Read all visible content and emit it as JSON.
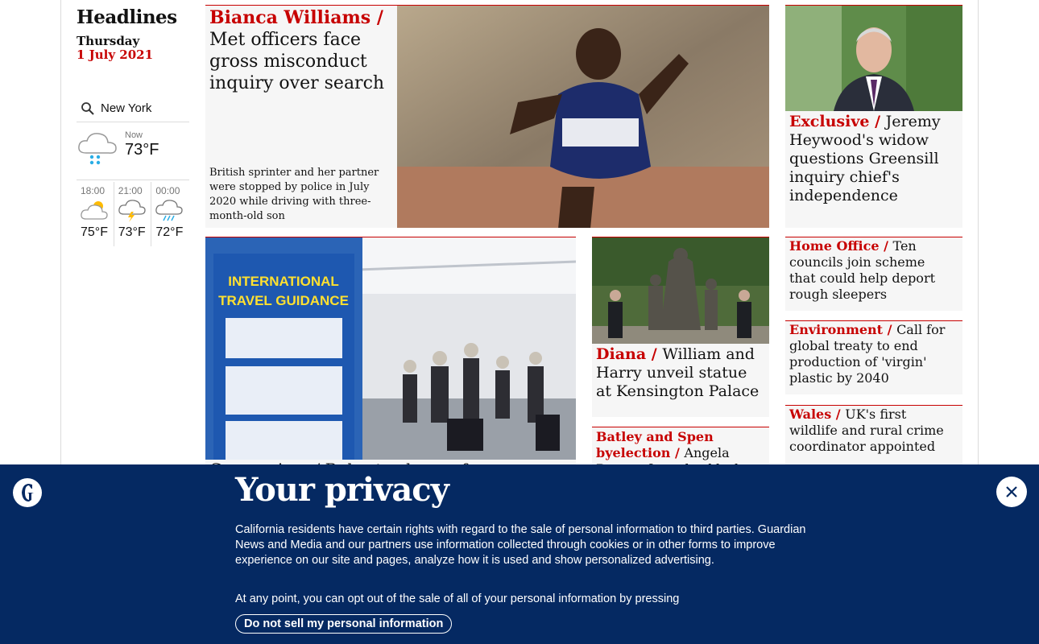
{
  "rail": {
    "title": "Headlines",
    "day": "Thursday",
    "date": "1 July 2021",
    "location": "New York",
    "now_label": "Now",
    "now_temp": "73°F",
    "forecast": [
      {
        "time": "18:00",
        "temp": "75°F",
        "icon": "partly-cloudy-icon"
      },
      {
        "time": "21:00",
        "temp": "73°F",
        "icon": "thunder-icon"
      },
      {
        "time": "00:00",
        "temp": "72°F",
        "icon": "rain-icon"
      }
    ]
  },
  "stories": {
    "main": {
      "kicker": "Bianca Williams",
      "headline": "Met officers face gross misconduct inquiry over search",
      "standfirst": "British sprinter and her partner were stopped by police in July 2020 while driving with three-month-old son"
    },
    "travel": {
      "peek": "Coronavirus / Rules to change for"
    },
    "diana": {
      "kicker": "Diana",
      "headline": "William and Harry unveil statue at Kensington Palace"
    },
    "batley": {
      "kicker": "Batley and Spen byelection",
      "headline": "Angela Rayner faces backlash"
    },
    "greensill": {
      "kicker": "Exclusive",
      "headline": "Jeremy Heywood's widow questions Greensill inquiry chief's independence"
    },
    "home_office": {
      "kicker": "Home Office",
      "headline": "Ten councils join scheme that could help deport rough sleepers"
    },
    "environment": {
      "kicker": "Environment",
      "headline": "Call for global treaty to end production of 'virgin' plastic by 2040"
    },
    "wales": {
      "kicker": "Wales",
      "headline": "UK's first wildlife and rural crime coordinator appointed"
    }
  },
  "privacy": {
    "title": "Your privacy",
    "body": "California residents have certain rights with regard to the sale of personal information to third parties. Guardian News and Media and our partners use information collected through cookies or in other forms to improve experience on our site and pages, analyze how it is used and show personalized advertising.",
    "body2": "At any point, you can opt out of the sale of all of your personal information by pressing",
    "button": "Do not sell my personal information"
  },
  "colors": {
    "accent": "#c70000",
    "banner": "#052962"
  }
}
